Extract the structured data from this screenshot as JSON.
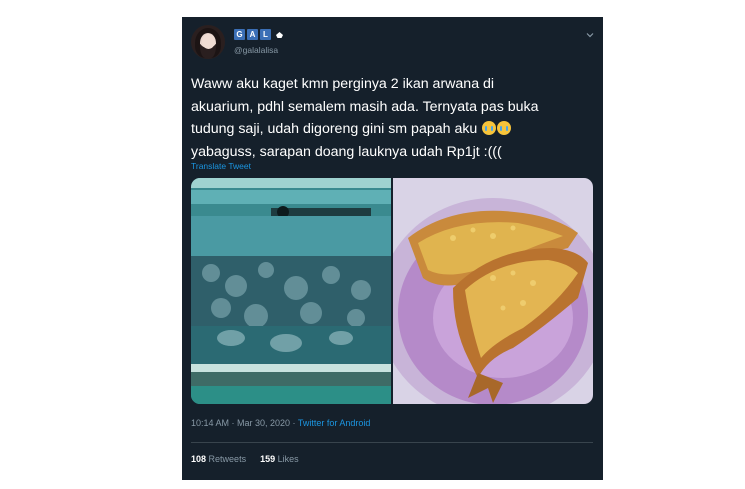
{
  "tweet": {
    "name_letters": [
      "G",
      "A",
      "L"
    ],
    "handle": "@galalalisa",
    "text_lines": [
      "Waww aku kaget kmn perginya 2 ikan arwana di",
      "akuarium, pdhl semalem masih ada. Ternyata pas buka",
      "tudung saji, udah digoreng gini sm papah aku",
      " yabaguss, sarapan doang lauknya udah Rp1jt :((("
    ],
    "translate_label": "Translate Tweet",
    "time": "10:14 AM · Mar 30, 2020 · ",
    "source": "Twitter for Android",
    "retweets_count": "108",
    "retweets_label": "Retweets",
    "likes_count": "159",
    "likes_label": "Likes",
    "icons": {
      "menu": "chevron-down-icon",
      "emoji": "loudly-crying-face-icon",
      "badge": "small-white-emblem-icon"
    }
  }
}
